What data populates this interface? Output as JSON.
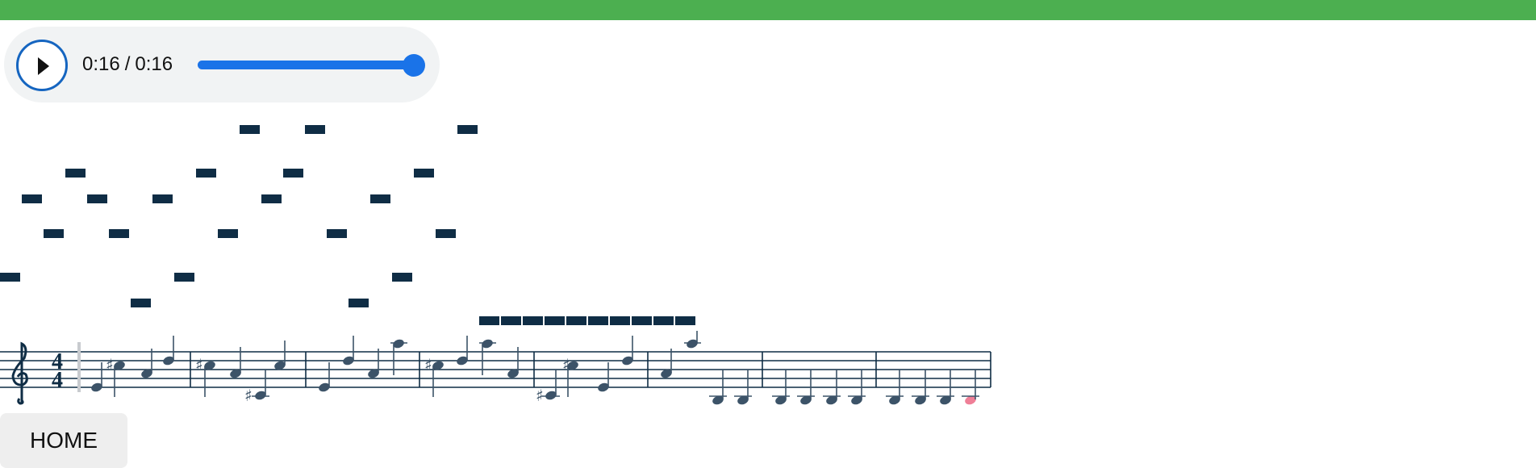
{
  "player": {
    "current_time": "0:16",
    "separator": "/",
    "duration": "0:16",
    "progress": 1.0
  },
  "score": {
    "time_signature": {
      "numerator": "4",
      "denominator": "4"
    }
  },
  "home_button": {
    "label": "HOME"
  },
  "colors": {
    "top_bar": "#4caf50",
    "player_background": "#f1f3f4",
    "play_button_ring": "#1565c0",
    "seek_accent": "#1a73e8",
    "note_bar": "#0f2d45",
    "score_note": "#3c5368",
    "current_note": "#ef7f97"
  },
  "icons": {
    "play": "play-icon",
    "clef": "treble-clef-icon",
    "sharp": "sharp-icon"
  }
}
